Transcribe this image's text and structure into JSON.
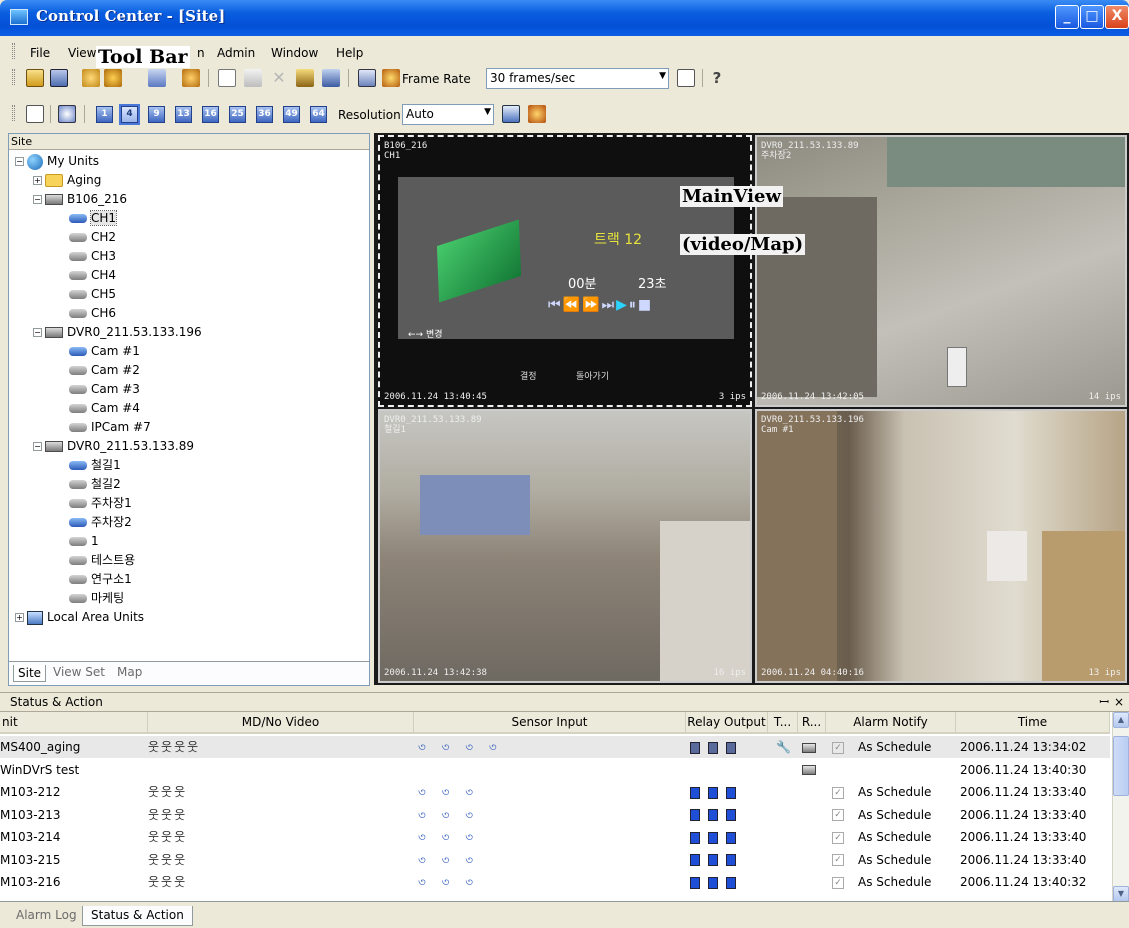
{
  "window": {
    "title": "Control Center - [Site]",
    "minimize": "_",
    "maximize": "□",
    "close": "X"
  },
  "menu": {
    "items": [
      "File",
      "View",
      "n",
      "Admin",
      "Window",
      "Help"
    ]
  },
  "callouts": {
    "toolbar": "Tool Bar",
    "mainview_line1": "MainView",
    "mainview_line2": "(video/Map)"
  },
  "toolbar1": {
    "frame_rate_label": "Frame Rate",
    "frame_rate_value": "30 frames/sec",
    "help_icon": "?"
  },
  "toolbar2": {
    "layouts": [
      "1",
      "4",
      "9",
      "13",
      "16",
      "25",
      "36",
      "49",
      "64"
    ],
    "resolution_label": "Resolution",
    "resolution_value": "Auto"
  },
  "site_panel": {
    "header": "Site",
    "tree": [
      {
        "label": "My Units"
      },
      {
        "label": "Aging"
      },
      {
        "label": "B106_216"
      },
      {
        "label": "CH1"
      },
      {
        "label": "CH2"
      },
      {
        "label": "CH3"
      },
      {
        "label": "CH4"
      },
      {
        "label": "CH5"
      },
      {
        "label": "CH6"
      },
      {
        "label": "DVR0_211.53.133.196"
      },
      {
        "label": "Cam #1"
      },
      {
        "label": "Cam #2"
      },
      {
        "label": "Cam #3"
      },
      {
        "label": "Cam #4"
      },
      {
        "label": "IPCam #7"
      },
      {
        "label": "DVR0_211.53.133.89"
      },
      {
        "label": "철길1"
      },
      {
        "label": "철길2"
      },
      {
        "label": "주차장1"
      },
      {
        "label": "주차장2"
      },
      {
        "label": "1"
      },
      {
        "label": "테스트용"
      },
      {
        "label": "연구소1"
      },
      {
        "label": "마케팅"
      },
      {
        "label": "Local Area Units"
      }
    ],
    "tabs": [
      "Site",
      "View Set",
      "Map"
    ]
  },
  "mainview": {
    "pane1": {
      "name": "B106_216",
      "channel": "CH1",
      "timestamp": "2006.11.24 13:40:45",
      "fps": "3 ips",
      "track_label": "트랙 12",
      "time_min": "00분",
      "time_sec": "23초",
      "bottom_left": "←→ 변경",
      "confirm": "결정",
      "back": "돌아가기"
    },
    "pane2": {
      "name": "DVR0_211.53.133.89",
      "channel": "주차장2",
      "timestamp": "2006.11.24 13:42:05",
      "fps": "14 ips"
    },
    "pane3": {
      "name": "DVR0_211.53.133.89",
      "channel": "철길1",
      "timestamp": "2006.11.24 13:42:38",
      "fps": "16 ips"
    },
    "pane4": {
      "name": "DVR0_211.53.133.196",
      "channel": "Cam #1",
      "timestamp": "2006.11.24 04:40:16",
      "fps": "13 ips"
    }
  },
  "status_panel": {
    "title": "Status & Action",
    "pin": "ꟷ",
    "close": "×",
    "columns": [
      "nit",
      "MD/No Video",
      "Sensor Input",
      "Relay Output",
      "T...",
      "R...",
      "Alarm Notify",
      "Time"
    ],
    "rows": [
      {
        "unit": "MS400_aging",
        "md": "웃웃웃웃",
        "sensor": "৩ ৩ ৩ ৩",
        "relay_count": 3,
        "alarm": "As Schedule",
        "time": "2006.11.24 13:34:02"
      },
      {
        "unit": "WinDVrS test",
        "md": "",
        "sensor": "",
        "relay_count": 0,
        "alarm": "",
        "time": "2006.11.24 13:40:30"
      },
      {
        "unit": "M103-212",
        "md": "웃웃웃",
        "sensor": "৩ ৩ ৩",
        "relay_count": 3,
        "alarm": "As Schedule",
        "time": "2006.11.24 13:33:40"
      },
      {
        "unit": "M103-213",
        "md": "웃웃웃",
        "sensor": "৩ ৩ ৩",
        "relay_count": 3,
        "alarm": "As Schedule",
        "time": "2006.11.24 13:33:40"
      },
      {
        "unit": "M103-214",
        "md": "웃웃웃",
        "sensor": "৩ ৩ ৩",
        "relay_count": 3,
        "alarm": "As Schedule",
        "time": "2006.11.24 13:33:40"
      },
      {
        "unit": "M103-215",
        "md": "웃웃웃",
        "sensor": "৩ ৩ ৩",
        "relay_count": 3,
        "alarm": "As Schedule",
        "time": "2006.11.24 13:33:40"
      },
      {
        "unit": "M103-216",
        "md": "웃웃웃",
        "sensor": "৩ ৩ ৩",
        "relay_count": 3,
        "alarm": "As Schedule",
        "time": "2006.11.24 13:40:32"
      }
    ]
  },
  "bottom_tabs": [
    "Alarm Log",
    "Status & Action"
  ]
}
